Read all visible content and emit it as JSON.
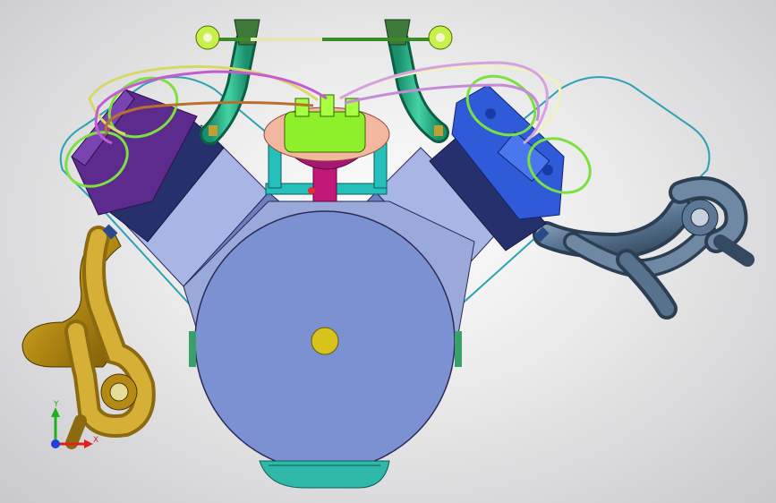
{
  "viewport": {
    "background": "#e6e6e8",
    "model": "v8-engine-assembly-front-view"
  },
  "triad": {
    "x_label": "X",
    "y_label": "Y",
    "x_color": "#e02020",
    "y_color": "#20b020",
    "z_color": "#2040e0"
  },
  "colors": {
    "block": "#7f93cf",
    "block_edge": "#2a2a55",
    "left_head": "#5d2a8e",
    "right_head": "#2f5bd8",
    "left_header": "#c29a22",
    "right_header": "#4d6f94",
    "intake_pipe": "#2fb38a",
    "distributor_cap": "#8ef02a",
    "distributor_base": "#f2b79e",
    "oil_pan": "#2fb7a8",
    "crank_hub": "#d8c21c",
    "ignition_wire_1": "#d8d86a",
    "ignition_wire_2": "#c55bd0",
    "ignition_wire_3": "#b9702e"
  },
  "icons": {
    "crank-hub": "crankshaft-hub-icon",
    "triad": "axis-triad-icon"
  }
}
